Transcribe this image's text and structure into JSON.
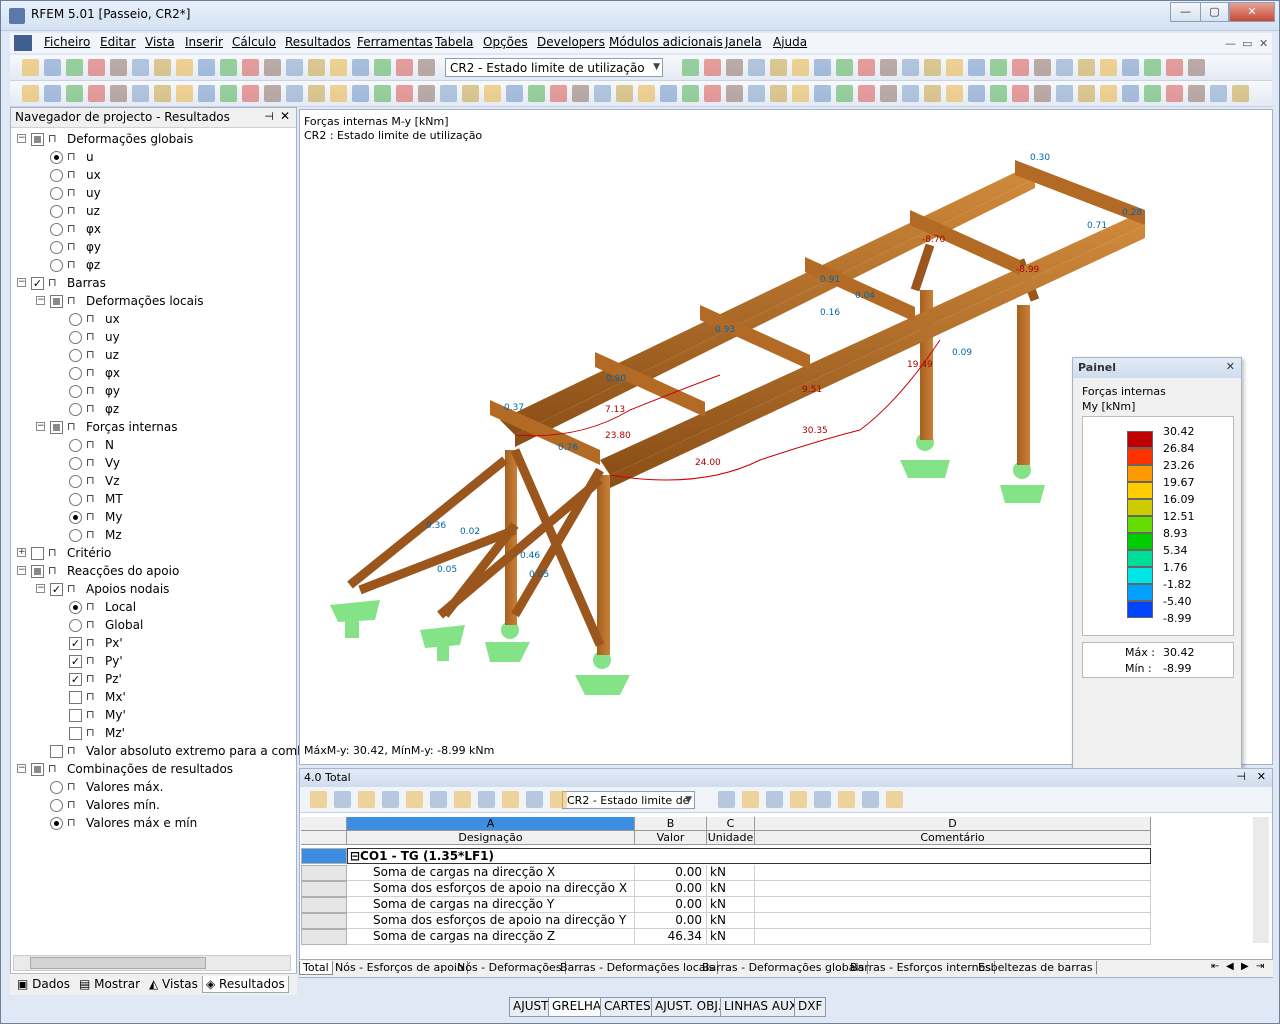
{
  "window": {
    "title": "RFEM 5.01 [Passeio, CR2*]",
    "min": "—",
    "max": "▢",
    "close": "✕"
  },
  "menu": [
    "Ficheiro",
    "Editar",
    "Vista",
    "Inserir",
    "Cálculo",
    "Resultados",
    "Ferramentas",
    "Tabela",
    "Opções",
    "Developers",
    "Módulos adicionais",
    "Janela",
    "Ajuda"
  ],
  "toolbar": {
    "load_case": "CR2 - Estado limite de utilização"
  },
  "navigator": {
    "title": "Navegador de projecto - Resultados",
    "items": [
      {
        "label": "Deformações globais",
        "kind": "cb",
        "state": "partial",
        "indent": 0,
        "exp": "−"
      },
      {
        "label": "u",
        "kind": "rb",
        "state": "on",
        "indent": 1
      },
      {
        "label": "ux",
        "kind": "rb",
        "state": "off",
        "indent": 1
      },
      {
        "label": "uy",
        "kind": "rb",
        "state": "off",
        "indent": 1
      },
      {
        "label": "uz",
        "kind": "rb",
        "state": "off",
        "indent": 1
      },
      {
        "label": "φx",
        "kind": "rb",
        "state": "off",
        "indent": 1
      },
      {
        "label": "φy",
        "kind": "rb",
        "state": "off",
        "indent": 1
      },
      {
        "label": "φz",
        "kind": "rb",
        "state": "off",
        "indent": 1
      },
      {
        "label": "Barras",
        "kind": "cb",
        "state": "on",
        "indent": 0,
        "exp": "−"
      },
      {
        "label": "Deformações locais",
        "kind": "cb",
        "state": "partial",
        "indent": 1,
        "exp": "−"
      },
      {
        "label": "ux",
        "kind": "rb",
        "state": "off",
        "indent": 2
      },
      {
        "label": "uy",
        "kind": "rb",
        "state": "off",
        "indent": 2
      },
      {
        "label": "uz",
        "kind": "rb",
        "state": "off",
        "indent": 2
      },
      {
        "label": "φx",
        "kind": "rb",
        "state": "off",
        "indent": 2
      },
      {
        "label": "φy",
        "kind": "rb",
        "state": "off",
        "indent": 2
      },
      {
        "label": "φz",
        "kind": "rb",
        "state": "off",
        "indent": 2
      },
      {
        "label": "Forças internas",
        "kind": "cb",
        "state": "partial",
        "indent": 1,
        "exp": "−"
      },
      {
        "label": "N",
        "kind": "rb",
        "state": "off",
        "indent": 2
      },
      {
        "label": "Vy",
        "kind": "rb",
        "state": "off",
        "indent": 2
      },
      {
        "label": "Vz",
        "kind": "rb",
        "state": "off",
        "indent": 2
      },
      {
        "label": "MT",
        "kind": "rb",
        "state": "off",
        "indent": 2
      },
      {
        "label": "My",
        "kind": "rb",
        "state": "on",
        "indent": 2
      },
      {
        "label": "Mz",
        "kind": "rb",
        "state": "off",
        "indent": 2
      },
      {
        "label": "Critério",
        "kind": "cb",
        "state": "off",
        "indent": 0,
        "exp": "+"
      },
      {
        "label": "Reacções do apoio",
        "kind": "cb",
        "state": "partial",
        "indent": 0,
        "exp": "−"
      },
      {
        "label": "Apoios nodais",
        "kind": "cb",
        "state": "on",
        "indent": 1,
        "exp": "−"
      },
      {
        "label": "Local",
        "kind": "rb",
        "state": "on",
        "indent": 2
      },
      {
        "label": "Global",
        "kind": "rb",
        "state": "off",
        "indent": 2
      },
      {
        "label": "Px'",
        "kind": "cb",
        "state": "on",
        "indent": 2
      },
      {
        "label": "Py'",
        "kind": "cb",
        "state": "on",
        "indent": 2
      },
      {
        "label": "Pz'",
        "kind": "cb",
        "state": "on",
        "indent": 2
      },
      {
        "label": "Mx'",
        "kind": "cb",
        "state": "off",
        "indent": 2
      },
      {
        "label": "My'",
        "kind": "cb",
        "state": "off",
        "indent": 2
      },
      {
        "label": "Mz'",
        "kind": "cb",
        "state": "off",
        "indent": 2
      },
      {
        "label": "Valor absoluto extremo para a combin",
        "kind": "cb",
        "state": "off",
        "indent": 1
      },
      {
        "label": "Combinações de resultados",
        "kind": "cb",
        "state": "partial",
        "indent": 0,
        "exp": "−"
      },
      {
        "label": "Valores máx.",
        "kind": "rb",
        "state": "off",
        "indent": 1
      },
      {
        "label": "Valores mín.",
        "kind": "rb",
        "state": "off",
        "indent": 1
      },
      {
        "label": "Valores máx e mín",
        "kind": "rb",
        "state": "on",
        "indent": 1
      }
    ],
    "tabs": [
      "Dados",
      "Mostrar",
      "Vistas",
      "Resultados"
    ]
  },
  "view": {
    "line1": "Forças internas M-y [kNm]",
    "line2": "CR2 : Estado limite de utilização",
    "footer": "MáxM-y: 30.42, MínM-y: -8.99 kNm",
    "labels": [
      "0.30",
      "0.28",
      "0.71",
      "-8.70",
      "-8.99",
      "0.91",
      "0.93",
      "0.90",
      "0.37",
      "0.76",
      "0.36",
      "0.02",
      "0.05",
      "0.46",
      "0.05",
      "23.80",
      "24.00",
      "30.35",
      "19.49",
      "9.51",
      "0.04",
      "7.13",
      "0.09",
      "0.16"
    ]
  },
  "painel": {
    "title": "Painel",
    "subtitle1": "Forças internas",
    "subtitle2": "My [kNm]",
    "scale": [
      {
        "value": "30.42",
        "color": "#c00000"
      },
      {
        "value": "26.84",
        "color": "#ff3300"
      },
      {
        "value": "23.26",
        "color": "#ff9900"
      },
      {
        "value": "19.67",
        "color": "#ffcc00"
      },
      {
        "value": "16.09",
        "color": "#cccc00"
      },
      {
        "value": "12.51",
        "color": "#66dd00"
      },
      {
        "value": "8.93",
        "color": "#00cc00"
      },
      {
        "value": "5.34",
        "color": "#00dd99"
      },
      {
        "value": "1.76",
        "color": "#00e5e5"
      },
      {
        "value": "-1.82",
        "color": "#00a0ff"
      },
      {
        "value": "-5.40",
        "color": "#0044ff"
      },
      {
        "value": "-8.99",
        "color": "#0000aa"
      }
    ],
    "max_label": "Máx :",
    "max_value": "30.42",
    "min_label": "Mín  :",
    "min_value": "-8.99"
  },
  "table": {
    "title": "4.0 Total",
    "combo": "CR2 - Estado limite de",
    "col_letters": [
      "A",
      "B",
      "C",
      "D"
    ],
    "col_names": [
      "Designação",
      "Valor",
      "Unidade",
      "Comentário"
    ],
    "group": "CO1 - TG  (1.35*LF1)",
    "rows": [
      {
        "name": "Soma de cargas na direcção X",
        "value": "0.00",
        "unit": "kN"
      },
      {
        "name": "Soma dos esforços de apoio na direcção X",
        "value": "0.00",
        "unit": "kN"
      },
      {
        "name": "Soma de cargas na direcção Y",
        "value": "0.00",
        "unit": "kN"
      },
      {
        "name": "Soma dos esforços de apoio na direcção Y",
        "value": "0.00",
        "unit": "kN"
      },
      {
        "name": "Soma de cargas na direcção Z",
        "value": "46.34",
        "unit": "kN"
      }
    ],
    "tabs": [
      "Total",
      "Nós - Esforços de apoio",
      "Nós - Deformações",
      "Barras - Deformações locais",
      "Barras - Deformações globais",
      "Barras - Esforços internos",
      "Esbeltezas de barras"
    ]
  },
  "status": [
    "AJUST",
    "GRELHA",
    "CARTES",
    "AJUST. OBJ.",
    "LINHAS AUX.",
    "DXF"
  ]
}
